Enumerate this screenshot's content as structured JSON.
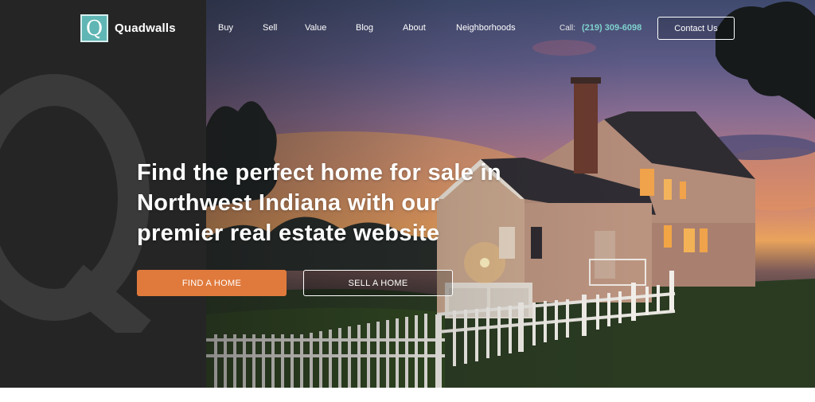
{
  "brand": {
    "mark_letter": "Q",
    "name": "Quadwalls",
    "accent": "#5fb6b4"
  },
  "nav": {
    "links": [
      "Buy",
      "Sell",
      "Value",
      "Blog",
      "About",
      "Neighborhoods"
    ],
    "call_label": "Call:",
    "phone": "(219) 309-6098",
    "contact_label": "Contact Us"
  },
  "hero": {
    "headline_lines": [
      "Find the perfect home for sale in",
      "Northwest Indiana with our",
      "premier real estate website"
    ],
    "primary_cta": "FIND A HOME",
    "secondary_cta": "SELL A HOME",
    "watermark_letter": "Q",
    "cta_color": "#e07a3c"
  }
}
